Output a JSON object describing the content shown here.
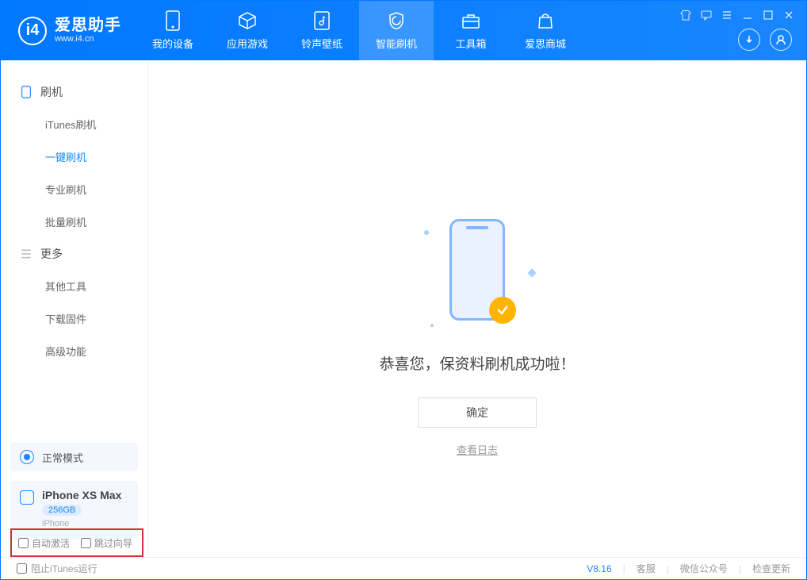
{
  "app": {
    "title": "爱思助手",
    "subtitle": "www.i4.cn"
  },
  "tabs": [
    {
      "label": "我的设备"
    },
    {
      "label": "应用游戏"
    },
    {
      "label": "铃声壁纸"
    },
    {
      "label": "智能刷机"
    },
    {
      "label": "工具箱"
    },
    {
      "label": "爱思商城"
    }
  ],
  "sidebar": {
    "group1": "刷机",
    "items1": [
      {
        "label": "iTunes刷机"
      },
      {
        "label": "一键刷机"
      },
      {
        "label": "专业刷机"
      },
      {
        "label": "批量刷机"
      }
    ],
    "group2": "更多",
    "items2": [
      {
        "label": "其他工具"
      },
      {
        "label": "下载固件"
      },
      {
        "label": "高级功能"
      }
    ],
    "status": "正常模式",
    "device": {
      "name": "iPhone XS Max",
      "capacity": "256GB",
      "type": "iPhone"
    }
  },
  "content": {
    "message": "恭喜您，保资料刷机成功啦！",
    "ok": "确定",
    "log": "查看日志"
  },
  "options": {
    "opt1": "自动激活",
    "opt2": "跳过向导"
  },
  "footer": {
    "blockItunes": "阻止iTunes运行",
    "version": "V8.16",
    "link1": "客服",
    "link2": "微信公众号",
    "link3": "检查更新"
  }
}
